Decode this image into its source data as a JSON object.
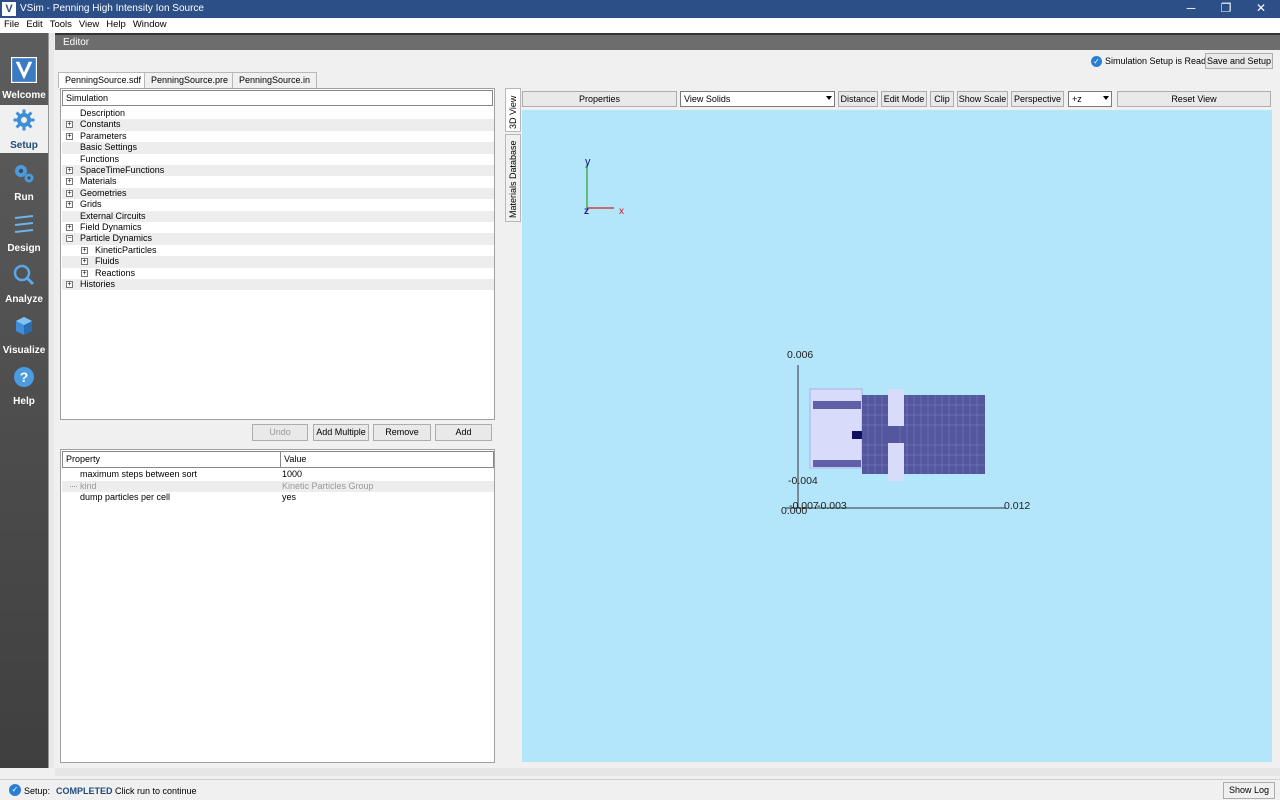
{
  "window": {
    "title": "VSim - Penning High Intensity Ion Source",
    "icon_letter": "V",
    "minimize": "─",
    "restore": "❐",
    "close": "✕"
  },
  "menu": [
    "File",
    "Edit",
    "Tools",
    "View",
    "Help",
    "Window"
  ],
  "nav": [
    {
      "label": "Welcome",
      "icon": "vsim-logo-icon"
    },
    {
      "label": "Setup",
      "icon": "gear-icon",
      "active": true
    },
    {
      "label": "Run",
      "icon": "gears-icon"
    },
    {
      "label": "Design",
      "icon": "design-icon"
    },
    {
      "label": "Analyze",
      "icon": "magnifier-icon"
    },
    {
      "label": "Visualize",
      "icon": "cube-icon"
    },
    {
      "label": "Help",
      "icon": "help-icon"
    }
  ],
  "editor": {
    "header": "Editor",
    "status_text": "Simulation Setup is Ready",
    "save_setup_label": "Save and Setup"
  },
  "file_tabs": [
    "PenningSource.sdf",
    "PenningSource.pre",
    "PenningSource.in"
  ],
  "tree": {
    "header": "Simulation",
    "items": [
      {
        "label": "Description",
        "expandable": false,
        "level": 0
      },
      {
        "label": "Constants",
        "expandable": true,
        "level": 0
      },
      {
        "label": "Parameters",
        "expandable": true,
        "level": 0
      },
      {
        "label": "Basic Settings",
        "expandable": false,
        "level": 0
      },
      {
        "label": "Functions",
        "expandable": false,
        "level": 0
      },
      {
        "label": "SpaceTimeFunctions",
        "expandable": true,
        "level": 0
      },
      {
        "label": "Materials",
        "expandable": true,
        "level": 0
      },
      {
        "label": "Geometries",
        "expandable": true,
        "level": 0
      },
      {
        "label": "Grids",
        "expandable": true,
        "level": 0
      },
      {
        "label": "External Circuits",
        "expandable": false,
        "level": 0
      },
      {
        "label": "Field Dynamics",
        "expandable": true,
        "level": 0
      },
      {
        "label": "Particle Dynamics",
        "expandable": true,
        "expanded": true,
        "level": 0
      },
      {
        "label": "KineticParticles",
        "expandable": true,
        "level": 1
      },
      {
        "label": "Fluids",
        "expandable": true,
        "level": 1
      },
      {
        "label": "Reactions",
        "expandable": true,
        "level": 1
      },
      {
        "label": "Histories",
        "expandable": true,
        "level": 0
      }
    ],
    "buttons": {
      "undo": "Undo",
      "add_multiple": "Add Multiple",
      "remove": "Remove",
      "add": "Add"
    }
  },
  "properties": {
    "headers": {
      "property": "Property",
      "value": "Value"
    },
    "rows": [
      {
        "name": "maximum steps between sort",
        "value": "1000"
      },
      {
        "name": "kind",
        "value": "Kinetic Particles Group",
        "disabled": true
      },
      {
        "name": "dump particles per cell",
        "value": "yes"
      }
    ]
  },
  "side_tabs": [
    "3D View",
    "Materials Database"
  ],
  "view_toolbar": {
    "properties": "Properties",
    "view_mode": "View Solids",
    "distance": "Distance",
    "edit_mode": "Edit Mode",
    "clip": "Clip",
    "show_scale": "Show Scale",
    "perspective": "Perspective",
    "camera_axis": "+z",
    "reset_view": "Reset View"
  },
  "viewport": {
    "background": "#b3e5fb",
    "axis_labels": {
      "y": "y",
      "z": "z",
      "x": "x"
    },
    "y_ticks": [
      "0.006",
      "-0.004"
    ],
    "x_ticks": [
      "-0.007",
      "-0.003",
      "0.012"
    ],
    "corner_label": "0.000"
  },
  "statusbar": {
    "prefix": "Setup:",
    "state": "COMPLETED",
    "message": "Click run to continue",
    "show_log": "Show Log"
  }
}
